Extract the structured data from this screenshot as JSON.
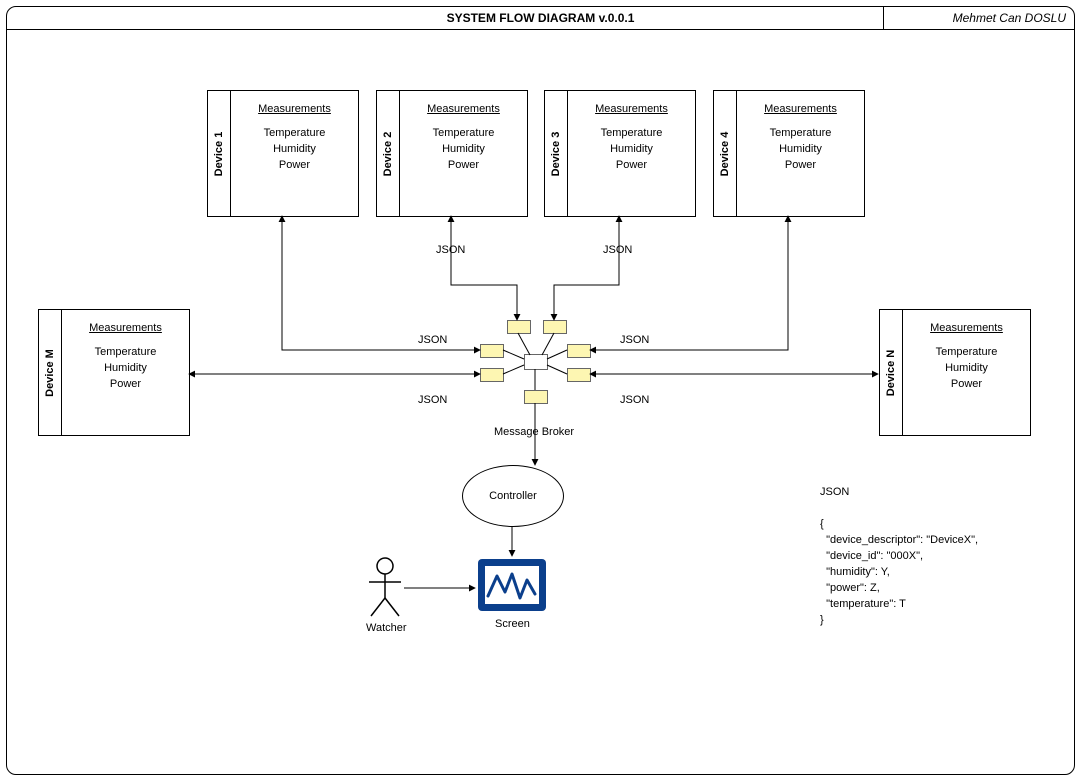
{
  "header": {
    "title": "SYSTEM FLOW DIAGRAM  v.0.0.1",
    "author": "Mehmet Can DOSLU"
  },
  "device_box": {
    "heading": "Measurements",
    "lines": [
      "Temperature",
      "Humidity",
      "Power"
    ]
  },
  "devices": {
    "d1": "Device 1",
    "d2": "Device 2",
    "d3": "Device 3",
    "d4": "Device 4",
    "dm": "Device M",
    "dn": "Device N"
  },
  "labels": {
    "json": "JSON",
    "message_broker": "Message Broker",
    "controller": "Controller",
    "screen": "Screen",
    "watcher": "Watcher"
  },
  "json_example_title": "JSON",
  "json_example_body": "{\n  \"device_descriptor\": \"DeviceX\",\n  \"device_id\": \"000X\",\n  \"humidity\": Y,\n  \"power\": Z,\n  \"temperature\": T\n}"
}
